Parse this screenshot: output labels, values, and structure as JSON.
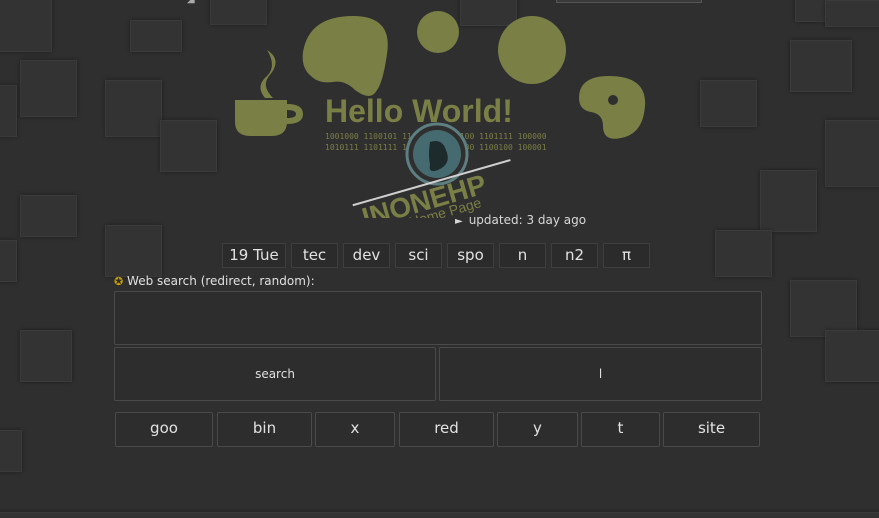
{
  "logo": {
    "headline": "Hello World!",
    "binary_line1": "1001000 1100101 1101100 1101100 1101111 100000",
    "binary_line2": "1010111 1101111 1110010 1101100 1100100 100001",
    "brand": "INONEHP",
    "tagline": "Home Page"
  },
  "status": {
    "arrow": "►",
    "updated": "updated: 3 day ago"
  },
  "tabs": [
    "19 Tue",
    "tec",
    "dev",
    "sci",
    "spo",
    "n",
    "n2",
    "π"
  ],
  "search": {
    "star": "✪",
    "label": "Web search (redirect, random):",
    "value": "",
    "search_button": "search",
    "second_button": "l"
  },
  "engines": [
    "goo",
    "bin",
    "x",
    "red",
    "y",
    "t",
    "site"
  ],
  "colors": {
    "background": "#2f2f2f",
    "logo_olive": "#7a7f45",
    "button_bg": "#2d2d2d",
    "star": "#c9a000"
  }
}
